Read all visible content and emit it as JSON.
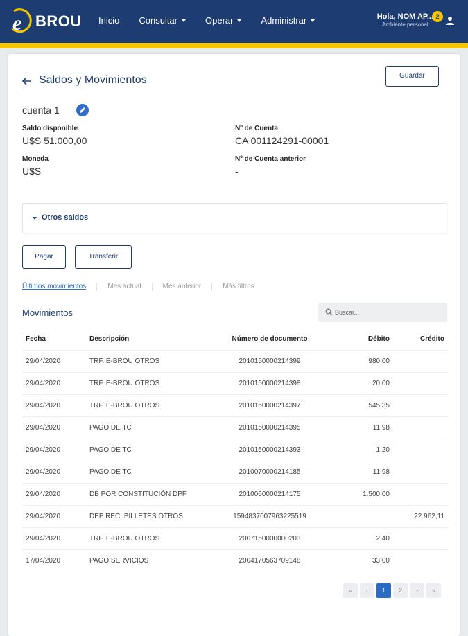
{
  "header": {
    "brand": "BROU",
    "nav": [
      {
        "label": "Inicio"
      },
      {
        "label": "Consultar"
      },
      {
        "label": "Operar"
      },
      {
        "label": "Administrar"
      }
    ],
    "user_greeting": "Hola, NOM AP...",
    "user_subtitle": "Ambiente personal",
    "notification_count": "2",
    "colors": {
      "navy": "#1d3c72",
      "yellow": "#f5c400",
      "accent_blue": "#2a6bc4"
    }
  },
  "page": {
    "title": "Saldos y Movimientos",
    "save_label": "Guardar",
    "account_name": "cuenta 1",
    "fields": {
      "saldo_label": "Saldo disponible",
      "saldo_value": "U$S 51.000,00",
      "cuenta_label": "Nº de Cuenta",
      "cuenta_value": "CA 001124291-00001",
      "moneda_label": "Moneda",
      "moneda_value": "U$S",
      "anterior_label": "Nº de Cuenta anterior",
      "anterior_value": "-"
    },
    "otros_saldos": "Otros saldos",
    "actions": {
      "pagar": "Pagar",
      "transferir": "Transferir"
    },
    "tabs": [
      {
        "label": "Últimos movimientos",
        "active": true
      },
      {
        "label": "Mes actual",
        "active": false
      },
      {
        "label": "Mes anterior",
        "active": false
      },
      {
        "label": "Más filtros",
        "active": false
      }
    ]
  },
  "movements": {
    "title": "Movimientos",
    "search_placeholder": "Buscar...",
    "columns": {
      "fecha": "Fecha",
      "descripcion": "Descripción",
      "documento": "Número de documento",
      "debito": "Débito",
      "credito": "Crédito"
    },
    "rows": [
      {
        "fecha": "29/04/2020",
        "descripcion": "TRF. E-BROU OTROS",
        "documento": "2010150000214399",
        "debito": "980,00",
        "credito": ""
      },
      {
        "fecha": "29/04/2020",
        "descripcion": "TRF. E-BROU OTROS",
        "documento": "2010150000214398",
        "debito": "20,00",
        "credito": ""
      },
      {
        "fecha": "29/04/2020",
        "descripcion": "TRF. E-BROU OTROS",
        "documento": "2010150000214397",
        "debito": "545,35",
        "credito": ""
      },
      {
        "fecha": "29/04/2020",
        "descripcion": "PAGO DE TC",
        "documento": "2010150000214395",
        "debito": "11,98",
        "credito": ""
      },
      {
        "fecha": "29/04/2020",
        "descripcion": "PAGO DE TC",
        "documento": "2010150000214393",
        "debito": "1,20",
        "credito": ""
      },
      {
        "fecha": "29/04/2020",
        "descripcion": "PAGO DE TC",
        "documento": "2010070000214185",
        "debito": "11,98",
        "credito": ""
      },
      {
        "fecha": "29/04/2020",
        "descripcion": "DB POR CONSTITUCIÓN DPF",
        "documento": "2010060000214175",
        "debito": "1.500,00",
        "credito": ""
      },
      {
        "fecha": "29/04/2020",
        "descripcion": "DEP REC. BILLETES OTROS",
        "documento": "1594837007963225519",
        "debito": "",
        "credito": "22.962,11"
      },
      {
        "fecha": "29/04/2020",
        "descripcion": "TRF. E-BROU OTROS",
        "documento": "2007150000000203",
        "debito": "2,40",
        "credito": ""
      },
      {
        "fecha": "17/04/2020",
        "descripcion": "PAGO SERVICIOS",
        "documento": "2004170563709148",
        "debito": "33,00",
        "credito": ""
      }
    ]
  },
  "pagination": {
    "first": "«",
    "prev": "‹",
    "pages": [
      "1",
      "2"
    ],
    "current": "1",
    "next": "›",
    "last": "»"
  }
}
